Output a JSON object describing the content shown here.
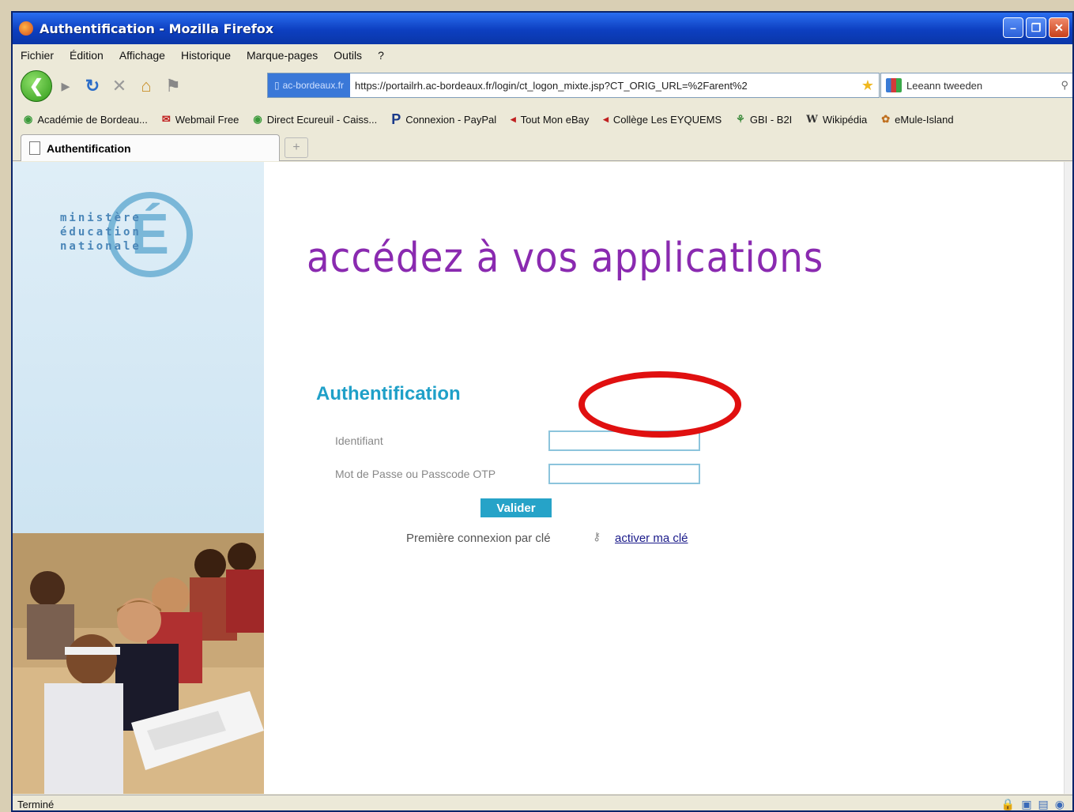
{
  "window": {
    "title": "Authentification - Mozilla Firefox",
    "minimize": "–",
    "maximize": "❐",
    "close": "✕"
  },
  "menu": [
    "Fichier",
    "Édition",
    "Affichage",
    "Historique",
    "Marque-pages",
    "Outils",
    "?"
  ],
  "nav": {
    "url": "https://portailrh.ac-bordeaux.fr/login/ct_logon_mixte.jsp?CT_ORIG_URL=%2Farent%2",
    "site_badge": "ac-bordeaux.fr",
    "search_text": "Leeann tweeden"
  },
  "bookmarks": [
    {
      "label": "Académie de Bordeau...",
      "icon": "◉"
    },
    {
      "label": "Webmail Free",
      "icon": "✉"
    },
    {
      "label": "Direct Ecureuil - Caiss...",
      "icon": "◉"
    },
    {
      "label": "Connexion - PayPal",
      "icon": "P"
    },
    {
      "label": "Tout Mon eBay",
      "icon": "◂"
    },
    {
      "label": "Collège Les EYQUEMS",
      "icon": "◂"
    },
    {
      "label": "GBI - B2I",
      "icon": "⚘"
    },
    {
      "label": "Wikipédia",
      "icon": "W"
    },
    {
      "label": "eMule-Island",
      "icon": "✿"
    }
  ],
  "tab": {
    "label": "Authentification",
    "newtab": "+"
  },
  "logo": {
    "text": "ministère\néducation\nnationale",
    "letter": "É"
  },
  "page": {
    "heading": "accédez à vos applications",
    "auth_title": "Authentification",
    "identifiant_label": "Identifiant",
    "password_label": "Mot de Passe ou Passcode OTP",
    "validate": "Valider",
    "premiere": "Première connexion par clé",
    "activate": "activer ma clé"
  },
  "status": {
    "text": "Terminé"
  }
}
